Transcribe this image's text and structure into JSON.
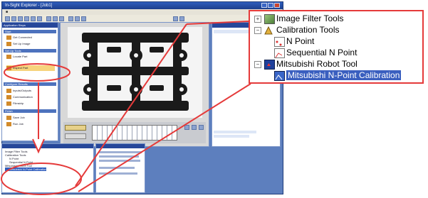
{
  "app": {
    "window_title": "In-Sight Explorer - [Job1]"
  },
  "left_pane": {
    "title": "Application Steps",
    "sections": [
      "Start",
      "Set Up Tools",
      "Configure Results",
      "Finish"
    ],
    "items": [
      "Get Connected",
      "Set Up Image",
      "Locate Part",
      "Inspect Part",
      "Inputs/Outputs",
      "Communication",
      "Filmstrip",
      "Save Job",
      "Run Job"
    ]
  },
  "bottom_left_tree": {
    "items": [
      "Image Filter Tools",
      "Calibration Tools",
      "N Point",
      "Sequential N Point",
      "Mitsubishi Robot Tool",
      "Mitsubishi N-Point Calibration"
    ]
  },
  "popup_tree": {
    "items": [
      {
        "label": "Image Filter Tools",
        "level": 0,
        "expander": "+",
        "icon": "image-filter-icon"
      },
      {
        "label": "Calibration Tools",
        "level": 0,
        "expander": "−",
        "icon": "calibration-icon"
      },
      {
        "label": "N Point",
        "level": 1,
        "expander": "",
        "icon": "n-point-icon"
      },
      {
        "label": "Sequential N Point",
        "level": 1,
        "expander": "",
        "icon": "sequential-n-point-icon"
      },
      {
        "label": "Mitsubishi Robot Tool",
        "level": 0,
        "expander": "−",
        "icon": "mitsubishi-robot-icon"
      },
      {
        "label": "Mitsubishi N-Point Calibration",
        "level": 1,
        "expander": "",
        "icon": "mitsubishi-n-point-icon"
      }
    ]
  },
  "colors": {
    "highlight": "#e53a3a",
    "window_blue": "#5d7fbe",
    "header_blue": "#26479a"
  }
}
